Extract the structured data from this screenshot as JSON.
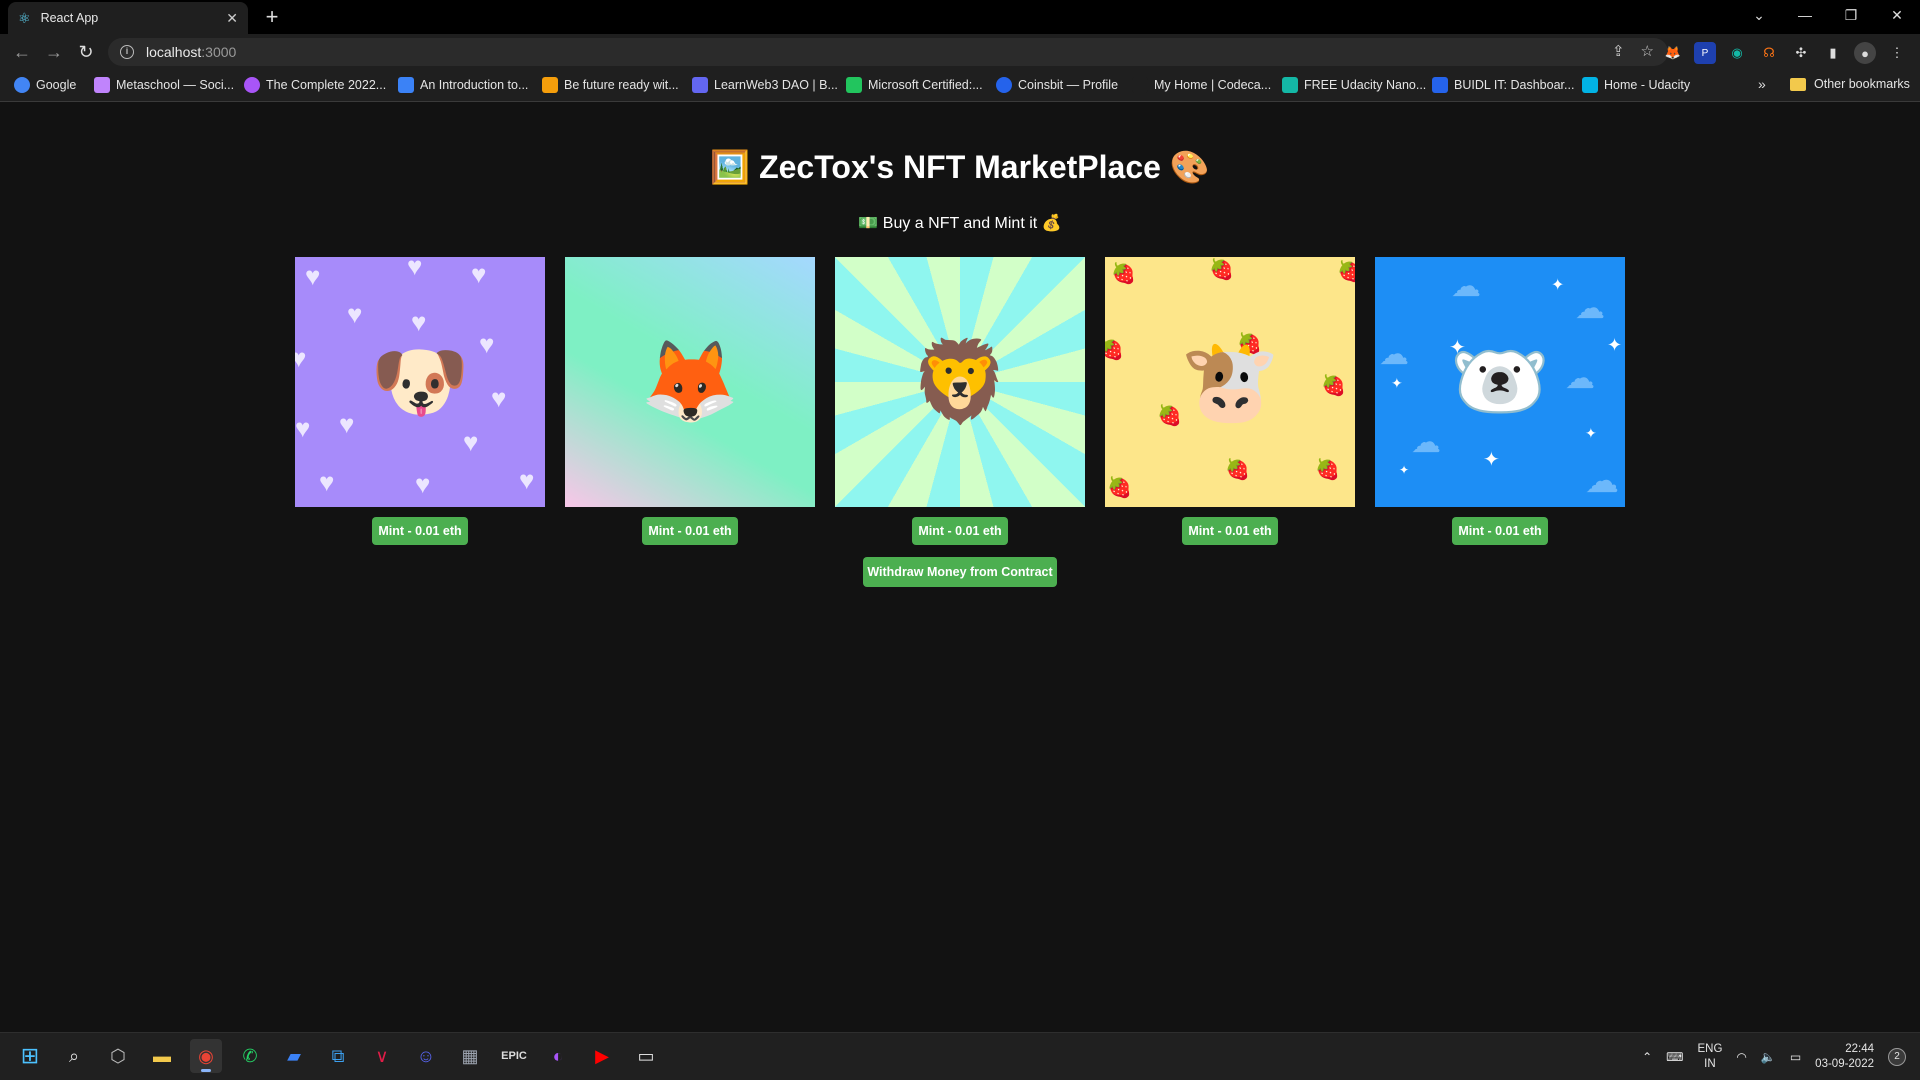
{
  "browser": {
    "tab": {
      "title": "React App",
      "favicon": "react-icon"
    },
    "address": {
      "host": "localhost",
      "port": ":3000"
    },
    "bookmarks": [
      {
        "label": "Google",
        "color": "#4285f4"
      },
      {
        "label": "Metaschool — Soci...",
        "color": "#c084fc"
      },
      {
        "label": "The Complete 2022...",
        "color": "#a855f7"
      },
      {
        "label": "An Introduction to...",
        "color": "#3b82f6"
      },
      {
        "label": "Be future ready wit...",
        "color": "#f59e0b"
      },
      {
        "label": "LearnWeb3 DAO | B...",
        "color": "#6366f1"
      },
      {
        "label": "Microsoft Certified:...",
        "color": "#22c55e"
      },
      {
        "label": "Coinsbit — Profile",
        "color": "#2563eb"
      },
      {
        "label": "My Home | Codeca...",
        "color": "#1f1f1f"
      },
      {
        "label": "FREE Udacity Nano...",
        "color": "#14b8a6"
      },
      {
        "label": "BUIDL IT: Dashboar...",
        "color": "#2563eb"
      },
      {
        "label": "Home - Udacity",
        "color": "#02b3e4"
      }
    ],
    "other_bookmarks": "Other bookmarks"
  },
  "page": {
    "title": "🖼️ ZecTox's NFT MarketPlace 🎨",
    "subtitle": "💵 Buy a NFT and Mint it 💰",
    "nfts": [
      {
        "animal": "🐶",
        "theme": "hearts",
        "mint_label": "Mint - 0.01 eth"
      },
      {
        "animal": "🦊",
        "theme": "gradient",
        "mint_label": "Mint - 0.01 eth"
      },
      {
        "animal": "🦁",
        "theme": "sunburst",
        "mint_label": "Mint - 0.01 eth"
      },
      {
        "animal": "🐮",
        "theme": "strawberries",
        "mint_label": "Mint - 0.01 eth"
      },
      {
        "animal": "🐻‍❄️",
        "theme": "sky",
        "mint_label": "Mint - 0.01 eth"
      }
    ],
    "withdraw_label": "Withdraw Money from Contract"
  },
  "taskbar": {
    "lang_top": "ENG",
    "lang_bottom": "IN",
    "time": "22:44",
    "date": "03-09-2022",
    "notifications": "2"
  }
}
